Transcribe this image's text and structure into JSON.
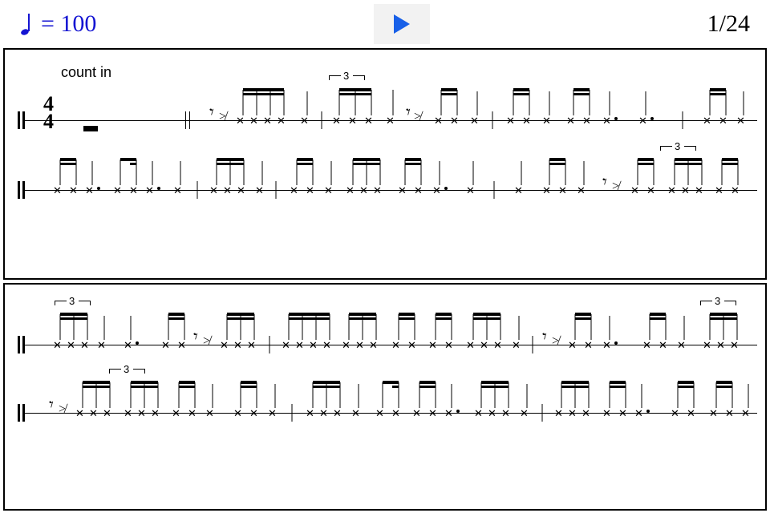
{
  "tempo": {
    "bpm": 100,
    "note": "quarter",
    "display": "= 100"
  },
  "transport": {
    "play_icon": "play"
  },
  "pagination": {
    "current": 1,
    "total": 24,
    "display": "1/24"
  },
  "score": {
    "time_signature": {
      "num": "4",
      "den": "4"
    },
    "systems": [
      {
        "label": "count in",
        "staves": 2,
        "tuplets": [
          "3",
          "3"
        ]
      },
      {
        "staves": 2,
        "tuplets": [
          "3",
          "3",
          "3"
        ]
      }
    ]
  }
}
